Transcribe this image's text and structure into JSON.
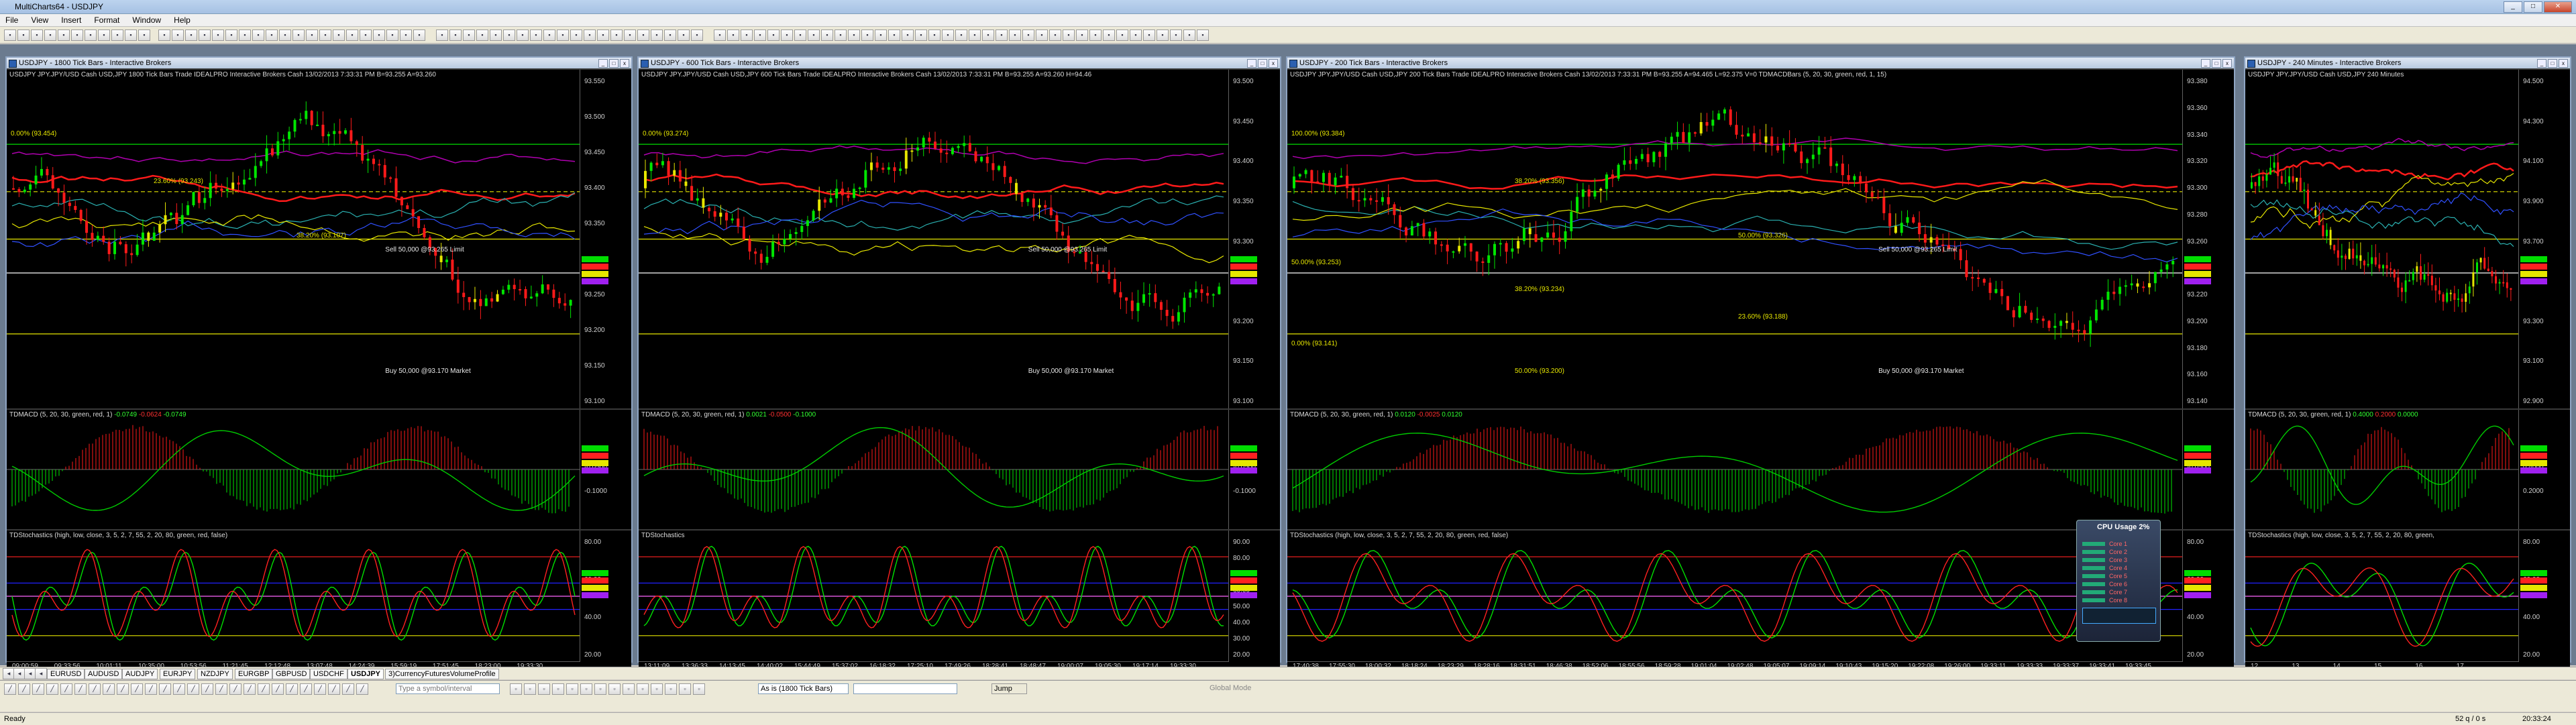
{
  "app": {
    "title": "MultiCharts64 - USDJPY",
    "window_buttons": [
      "_",
      "□",
      "✕"
    ]
  },
  "menu": [
    "File",
    "View",
    "Insert",
    "Format",
    "Window",
    "Help"
  ],
  "windows": [
    {
      "title": "USDJPY - 1800 Tick Bars - Interactive Brokers",
      "price_label": "USDJPY  JPY.JPY/USD Cash USD,JPY  1800 Tick Bars   Trade  IDEALPRO  Interactive Brokers  Cash  13/02/2013  7:33:31 PM  B=93.255  A=93.260",
      "price_ticks": [
        "93.550",
        "93.500",
        "93.450",
        "93.400",
        "93.350",
        "93.300",
        "93.250",
        "93.200",
        "93.150",
        "93.100"
      ],
      "fib": [
        "0.00% (93.454)",
        "23.60% (93.243)",
        "38.20% (93.107)"
      ],
      "notes": [
        "Sell 50,000 @93.265 Limit",
        "Buy 50,000 @93.170 Market"
      ],
      "macd_label": "TDMACD (5, 20, 30, green, red, 1)",
      "macd_vals": [
        "-0.0749",
        "-0.0624",
        "-0.0749"
      ],
      "macd_ticks": [
        "-0.0500",
        "-0.1000"
      ],
      "stoch_label": "TDStochastics (high, low, close, 3, 5, 2, 7, 55, 2, 20, 80, green, red, false)",
      "stoch_ticks": [
        "80.00",
        "60.00",
        "40.00",
        "20.00"
      ],
      "times": [
        "09:00:59",
        "09:33:56",
        "10:01:11",
        "10:35:00",
        "10:53:56",
        "11:21:45",
        "12:12:48",
        "13:07:48",
        "14:24:39",
        "15:59:19",
        "17:51:45",
        "18:23:00",
        "19:33:30"
      ]
    },
    {
      "title": "USDJPY - 600 Tick Bars - Interactive Brokers",
      "price_label": "USDJPY  JPY.JPY/USD Cash USD,JPY  600 Tick Bars   Trade  IDEALPRO  Interactive Brokers  Cash  13/02/2013  7:33:31 PM  B=93.255  A=93.260  H=94.46",
      "price_ticks": [
        "93.500",
        "93.450",
        "93.400",
        "93.350",
        "93.300",
        "93.250",
        "93.200",
        "93.150",
        "93.100"
      ],
      "fib": [
        "0.00% (93.274)"
      ],
      "notes": [
        "Sell 50,000 @93.265 Limit",
        "Buy 50,000 @93.170 Market"
      ],
      "macd_label": "TDMACD (5, 20, 30, green, red, 1)",
      "macd_vals": [
        "0.0021",
        "-0.0500",
        "-0.1000"
      ],
      "macd_ticks": [
        "-0.0500",
        "-0.1000"
      ],
      "stoch_label": "TDStochastics",
      "stoch_ticks": [
        "90.00",
        "80.00",
        "70.00",
        "60.00",
        "50.00",
        "40.00",
        "30.00",
        "20.00"
      ],
      "times": [
        "13:11:09",
        "13:36:33",
        "14:13:45",
        "14:40:02",
        "15:44:49",
        "15:37:02",
        "16:18:32",
        "17:25:10",
        "17:49:26",
        "18:28:41",
        "18:48:47",
        "19:00:07",
        "19:05:30",
        "19:17:14",
        "19:33:30"
      ]
    },
    {
      "title": "USDJPY - 200 Tick Bars - Interactive Brokers",
      "price_label": "USDJPY  JPY.JPY/USD Cash USD,JPY  200 Tick Bars   Trade  IDEALPRO  Interactive Brokers  Cash  13/02/2013  7:33:31 PM  B=93.255  A=94.465  L=92.375  V=0  TDMACDBars (5, 20, 30, green, red, 1, 15)",
      "price_ticks": [
        "93.380",
        "93.360",
        "93.340",
        "93.320",
        "93.300",
        "93.280",
        "93.260",
        "93.240",
        "93.220",
        "93.200",
        "93.180",
        "93.160",
        "93.140"
      ],
      "fib": [
        "100.00% (93.384)",
        "38.20% (93.356)",
        "50.00% (93.326)",
        "50.00% (93.253)",
        "38.20% (93.234)",
        "23.60% (93.188)",
        "0.00% (93.141)",
        "50.00% (93.200)"
      ],
      "notes": [
        "Sell 50,000 @93.265 Limit",
        "Buy 50,000 @93.170 Market"
      ],
      "macd_label": "TDMACD (5, 20, 30, green, red, 1)",
      "macd_vals": [
        "0.0120",
        "-0.0025",
        "0.0120"
      ],
      "macd_ticks": [
        "-0.0500"
      ],
      "stoch_label": "TDStochastics (high, low, close, 3, 5, 2, 7, 55, 2, 20, 80, green, red, false)",
      "stoch_ticks": [
        "80.00",
        "60.00",
        "40.00",
        "20.00"
      ],
      "times": [
        "17:40:38",
        "17:55:30",
        "18:00:32",
        "18:18:24",
        "18:23:29",
        "18:28:16",
        "18:31:51",
        "18:46:38",
        "18:52:06",
        "18:55:56",
        "18:59:28",
        "19:01:04",
        "19:02:48",
        "19:05:07",
        "19:09:14",
        "19:10:43",
        "19:15:20",
        "19:22:08",
        "19:26:00",
        "19:33:11",
        "19:33:33",
        "19:33:37",
        "19:33:41",
        "19:33:45"
      ]
    },
    {
      "title": "USDJPY - 240 Minutes - Interactive Brokers",
      "price_label": "USDJPY  JPY.JPY/USD Cash USD,JPY  240 Minutes",
      "price_ticks": [
        "94.500",
        "94.300",
        "94.100",
        "93.900",
        "93.700",
        "93.500",
        "93.300",
        "93.100",
        "92.900"
      ],
      "fib": [],
      "notes": [],
      "macd_label": "TDMACD (5, 20, 30, green, red, 1)",
      "macd_vals": [
        "0.4000",
        "0.2000",
        "0.0000"
      ],
      "macd_ticks": [
        "0.4000",
        "0.2000"
      ],
      "stoch_label": "TDStochastics (high, low, close, 3, 5, 2, 7, 55, 2, 20, 80, green,",
      "stoch_ticks": [
        "80.00",
        "60.00",
        "40.00",
        "20.00"
      ],
      "times": [
        "12",
        "13",
        "14",
        "15",
        "16",
        "17"
      ]
    }
  ],
  "tabs": [
    "EURUSD",
    "AUDUSD",
    "AUDJPY",
    "EURJPY",
    "NZDJPY",
    "EURGBP",
    "GBPUSD",
    "USDCHF",
    "USDJPY",
    "3)CurrencyFuturesVolumeProfile"
  ],
  "active_tab": "USDJPY",
  "bottom": {
    "symbol_placeholder": "Type a symbol/interval",
    "interval_value": "As is (1800 Tick Bars)",
    "jump_label": "Jump",
    "global_mode_label": "Global Mode"
  },
  "cpu_widget": {
    "title": "CPU Usage",
    "pct": "2%",
    "cores": [
      "Core 1",
      "Core 2",
      "Core 3",
      "Core 4",
      "Core 5",
      "Core 6",
      "Core 7",
      "Core 8"
    ]
  },
  "status": {
    "left": "Ready",
    "right_a": "52 q / 0 s",
    "time": "20:33:24"
  },
  "colors": {
    "bull": "#00e600",
    "bear": "#ff1a1a",
    "fib": "#e6e600",
    "ma_red": "#ff1a1a",
    "ma_magenta": "#b000b0"
  }
}
